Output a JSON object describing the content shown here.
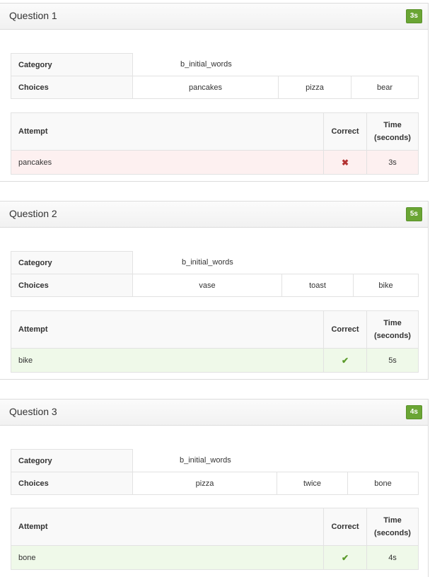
{
  "labels": {
    "category": "Category",
    "choices": "Choices",
    "attempt": "Attempt",
    "correct": "Correct",
    "time_line1": "Time",
    "time_line2": "(seconds)"
  },
  "questions": [
    {
      "title": "Question 1",
      "badge": "3s",
      "category": "b_initial_words",
      "choices": [
        "pancakes",
        "pizza",
        "bear"
      ],
      "attempt": "pancakes",
      "correct": false,
      "correct_icon": "cross-icon",
      "time": "3s"
    },
    {
      "title": "Question 2",
      "badge": "5s",
      "category": "b_initial_words",
      "choices": [
        "vase",
        "toast",
        "bike"
      ],
      "attempt": "bike",
      "correct": true,
      "correct_icon": "check-icon",
      "time": "5s"
    },
    {
      "title": "Question 3",
      "badge": "4s",
      "category": "b_initial_words",
      "choices": [
        "pizza",
        "twice",
        "bone"
      ],
      "attempt": "bone",
      "correct": true,
      "correct_icon": "check-icon",
      "time": "4s"
    }
  ],
  "colors": {
    "badge": "#6aa534",
    "wrong_row": "#fdf0f0",
    "right_row": "#eff9e9"
  }
}
